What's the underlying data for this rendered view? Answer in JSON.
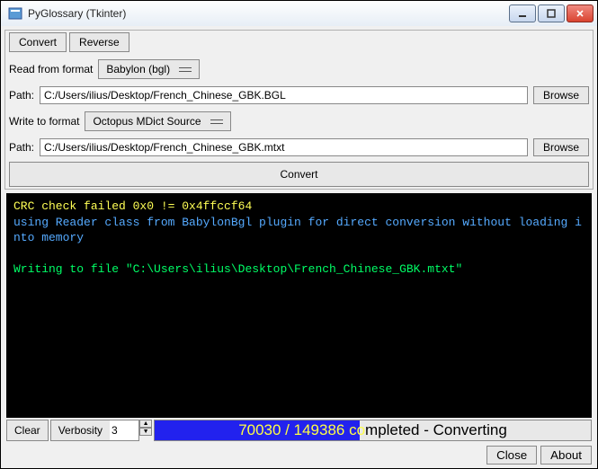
{
  "window": {
    "title": "PyGlossary (Tkinter)"
  },
  "tabs": {
    "convert": "Convert",
    "reverse": "Reverse"
  },
  "read": {
    "label": "Read from format",
    "format": "Babylon (bgl)",
    "path_label": "Path:",
    "path": "C:/Users/ilius/Desktop/French_Chinese_GBK.BGL",
    "browse": "Browse"
  },
  "write": {
    "label": "Write to format",
    "format": "Octopus MDict Source",
    "path_label": "Path:",
    "path": "C:/Users/ilius/Desktop/French_Chinese_GBK.mtxt",
    "browse": "Browse"
  },
  "convert_button": "Convert",
  "console": {
    "line1": "CRC check failed 0x0 != 0x4ffccf64",
    "line2": "using Reader class from BabylonBgl plugin for direct conversion without loading into memory",
    "line3": "Writing to file \"C:\\Users\\ilius\\Desktop\\French_Chinese_GBK.mtxt\""
  },
  "status": {
    "clear": "Clear",
    "verbosity_label": "Verbosity",
    "verbosity_value": "3",
    "progress_text": "70030 / 149386 completed - Converting",
    "progress_percent": 47
  },
  "footer": {
    "close": "Close",
    "about": "About"
  }
}
